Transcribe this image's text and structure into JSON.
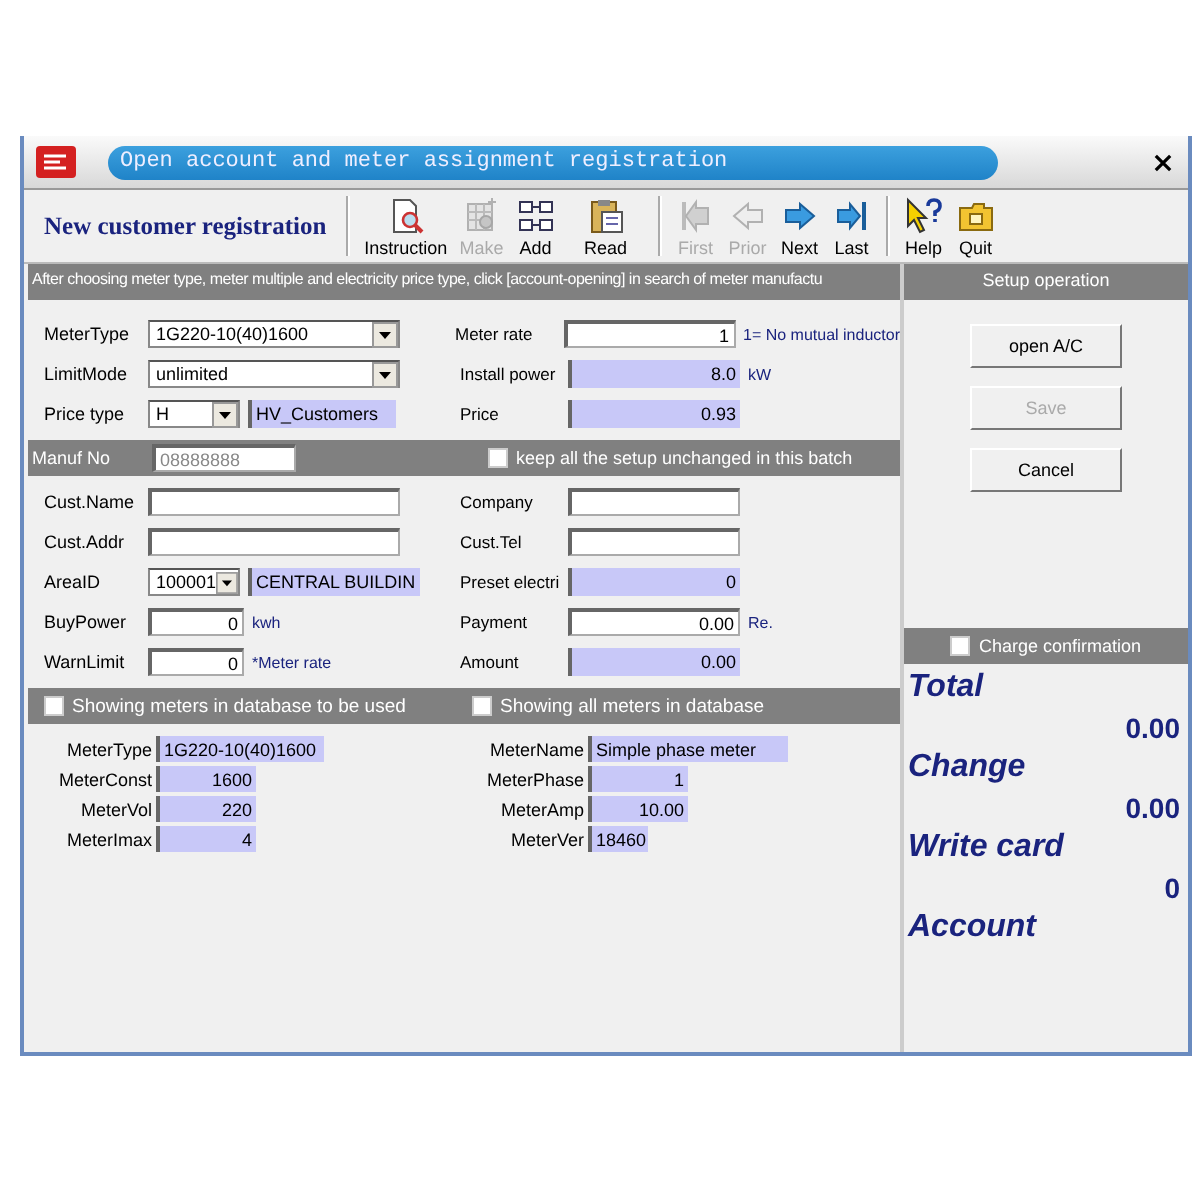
{
  "window": {
    "title": "Open account and meter assignment registration"
  },
  "toolbar": {
    "title": "New customer registration",
    "groups": [
      [
        {
          "kind": "instruction",
          "label": "Instruction",
          "disabled": false
        },
        {
          "kind": "make",
          "label": "Make",
          "disabled": true
        },
        {
          "kind": "add",
          "label": "Add",
          "disabled": false
        },
        {
          "kind": "read",
          "label": "Read",
          "disabled": false
        }
      ],
      [
        {
          "kind": "first",
          "label": "First",
          "disabled": true
        },
        {
          "kind": "prior",
          "label": "Prior",
          "disabled": true
        },
        {
          "kind": "next",
          "label": "Next",
          "disabled": false
        },
        {
          "kind": "last",
          "label": "Last",
          "disabled": false
        }
      ],
      [
        {
          "kind": "help",
          "label": "Help",
          "disabled": false
        },
        {
          "kind": "quit",
          "label": "Quit",
          "disabled": false
        }
      ]
    ]
  },
  "info_bar": "After choosing meter type, meter multiple and electricity price type, click [account-opening] in search of meter manufactu",
  "form_top": [
    {
      "left": {
        "label": "MeterType",
        "kind": "combo",
        "value": "1G220-10(40)1600"
      },
      "right": {
        "label": "Meter rate",
        "kind": "input",
        "value": "1",
        "numeric": true,
        "unit": "1= No mutual inductor"
      }
    },
    {
      "left": {
        "label": "LimitMode",
        "kind": "combo",
        "value": "unlimited"
      },
      "right": {
        "label": "Install power",
        "kind": "readonly",
        "value": "8.0",
        "numeric": true,
        "unit": "kW"
      }
    },
    {
      "left": {
        "label": "Price type",
        "kind": "combo",
        "value": "H",
        "extra": {
          "kind": "readonly",
          "value": "HV_Customers"
        }
      },
      "right": {
        "label": "Price",
        "kind": "readonly",
        "value": "0.93",
        "numeric": true
      }
    }
  ],
  "batch_bar": {
    "label": "Manuf No",
    "value": "08888888",
    "checkbox": {
      "label": "keep all the setup unchanged in this batch",
      "checked": false
    }
  },
  "form_customer": [
    {
      "left": {
        "label": "Cust.Name",
        "kind": "input"
      },
      "right": {
        "label": "Company",
        "kind": "input"
      }
    },
    {
      "left": {
        "label": "Cust.Addr",
        "kind": "input"
      },
      "right": {
        "label": "Cust.Tel",
        "kind": "input"
      }
    },
    {
      "left": {
        "label": "AreaID",
        "kind": "combo",
        "value": "100001",
        "extra": {
          "kind": "readonly",
          "value": "CENTRAL BUILDIN"
        }
      },
      "right": {
        "label": "Preset electri",
        "kind": "readonly",
        "value": "0",
        "numeric": true
      }
    },
    {
      "left": {
        "label": "BuyPower",
        "kind": "input",
        "value": "0",
        "numeric": true,
        "unit": "kwh"
      },
      "right": {
        "label": "Payment",
        "kind": "input",
        "value": "0.00",
        "numeric": true,
        "unit": "Re."
      }
    },
    {
      "left": {
        "label": "WarnLimit",
        "kind": "input",
        "value": "0",
        "numeric": true,
        "unit": "*Meter rate"
      },
      "right": {
        "label": "Amount",
        "kind": "readonly",
        "value": "0.00",
        "numeric": true
      }
    }
  ],
  "meter_filter": [
    {
      "label": "Showing meters in database to be used",
      "checked": false
    },
    {
      "label": "Showing all meters in database",
      "checked": false
    }
  ],
  "meter_info": {
    "left": [
      {
        "label": "MeterType",
        "value": "1G220-10(40)1600",
        "numeric": false
      },
      {
        "label": "MeterConst",
        "value": "1600",
        "numeric": true
      },
      {
        "label": "MeterVol",
        "value": "220",
        "numeric": true
      },
      {
        "label": "MeterImax",
        "value": "4",
        "numeric": true
      }
    ],
    "right": [
      {
        "label": "MeterName",
        "value": "Simple phase meter",
        "numeric": false
      },
      {
        "label": "MeterPhase",
        "value": "1",
        "numeric": true
      },
      {
        "label": "MeterAmp",
        "value": "10.00",
        "numeric": true
      },
      {
        "label": "MeterVer",
        "value": "18460",
        "numeric": false
      }
    ]
  },
  "setup": {
    "header": "Setup operation",
    "buttons": [
      {
        "label": "open A/C",
        "disabled": false
      },
      {
        "label": "Save",
        "disabled": true
      },
      {
        "label": "Cancel",
        "disabled": false
      }
    ]
  },
  "charge": {
    "checkbox": {
      "label": "Charge confirmation",
      "checked": false
    },
    "totals": [
      {
        "label": "Total",
        "value": "0.00"
      },
      {
        "label": "Change",
        "value": "0.00"
      },
      {
        "label": "Write card",
        "value": "0"
      },
      {
        "label": "Account"
      }
    ]
  }
}
